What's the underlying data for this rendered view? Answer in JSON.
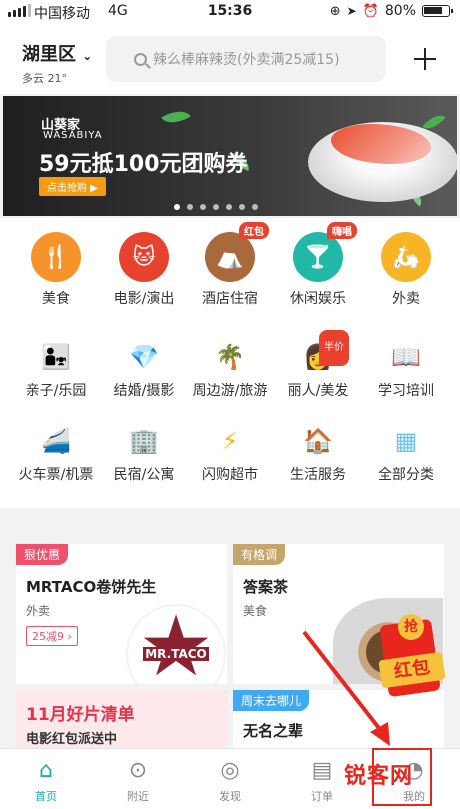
{
  "status": {
    "carrier": "中国移动",
    "network": "4G",
    "time": "15:36",
    "battery": "80%",
    "battery_level": 0.8
  },
  "header": {
    "city": "湖里区",
    "weather": "多云 21°",
    "search_placeholder": "辣么棒麻辣烫(外卖满25减15)"
  },
  "banner": {
    "brand": "山葵家",
    "brand_en": "WASABIYA",
    "headline": "59元抵100元团购券",
    "cta": "点击抢购 ▶",
    "page_count": 7,
    "active_index": 0
  },
  "categories": [
    {
      "label": "美食",
      "icon": "fork-knife-icon",
      "color": "#f7932b"
    },
    {
      "label": "电影/演出",
      "icon": "cat-icon",
      "color": "#e8422f"
    },
    {
      "label": "酒店住宿",
      "icon": "hotel-icon",
      "color": "#a86a3c",
      "badge": "红包"
    },
    {
      "label": "休闲娱乐",
      "icon": "cocktail-icon",
      "color": "#22b8a8",
      "badge": "嗨唱"
    },
    {
      "label": "外卖",
      "icon": "delivery-icon",
      "color": "#f7b525"
    },
    {
      "label": "亲子/乐园",
      "icon": "family-icon",
      "color": "#f26b6b"
    },
    {
      "label": "结婚/摄影",
      "icon": "diamond-icon",
      "color": "#f04a6d"
    },
    {
      "label": "周边游/旅游",
      "icon": "palm-tree-icon",
      "color": "#3fa9f5"
    },
    {
      "label": "丽人/美发",
      "icon": "lady-icon",
      "color": "#f46a8a",
      "badge": "半价"
    },
    {
      "label": "学习培训",
      "icon": "book-icon",
      "color": "#20b5a4"
    },
    {
      "label": "火车票/机票",
      "icon": "train-icon",
      "color": "#3fa9f5"
    },
    {
      "label": "民宿/公寓",
      "icon": "apartment-icon",
      "color": "#f7b525"
    },
    {
      "label": "闪购超市",
      "icon": "flash-icon",
      "color": "#f7b525"
    },
    {
      "label": "生活服务",
      "icon": "house-icon",
      "color": "#20b5a4"
    },
    {
      "label": "全部分类",
      "icon": "grid-icon",
      "color": "#6ec1f2"
    }
  ],
  "cards": {
    "taco": {
      "tag": "狠优惠",
      "title": "MRTACO卷饼先生",
      "sub": "外卖",
      "promo": "25减9 ›",
      "logo": "MR.TACO"
    },
    "tea": {
      "tag": "有格调",
      "title": "答案茶",
      "sub": "美食"
    },
    "movie": {
      "title": "11月好片清单",
      "sub": "电影红包派送中"
    },
    "weekend": {
      "tag": "周末去哪儿",
      "title": "无名之辈"
    }
  },
  "hongbao": {
    "top": "抢",
    "label": "红包"
  },
  "tabs": [
    {
      "label": "首页",
      "icon": "home-icon",
      "active": true
    },
    {
      "label": "附近",
      "icon": "location-pin-icon"
    },
    {
      "label": "发现",
      "icon": "compass-icon"
    },
    {
      "label": "订单",
      "icon": "clipboard-icon"
    },
    {
      "label": "我的",
      "icon": "user-icon"
    }
  ],
  "watermark": "锐客网",
  "colors": {
    "brand": "#14b1a4",
    "highlight": "#e8261d",
    "orange": "#f39c12"
  }
}
